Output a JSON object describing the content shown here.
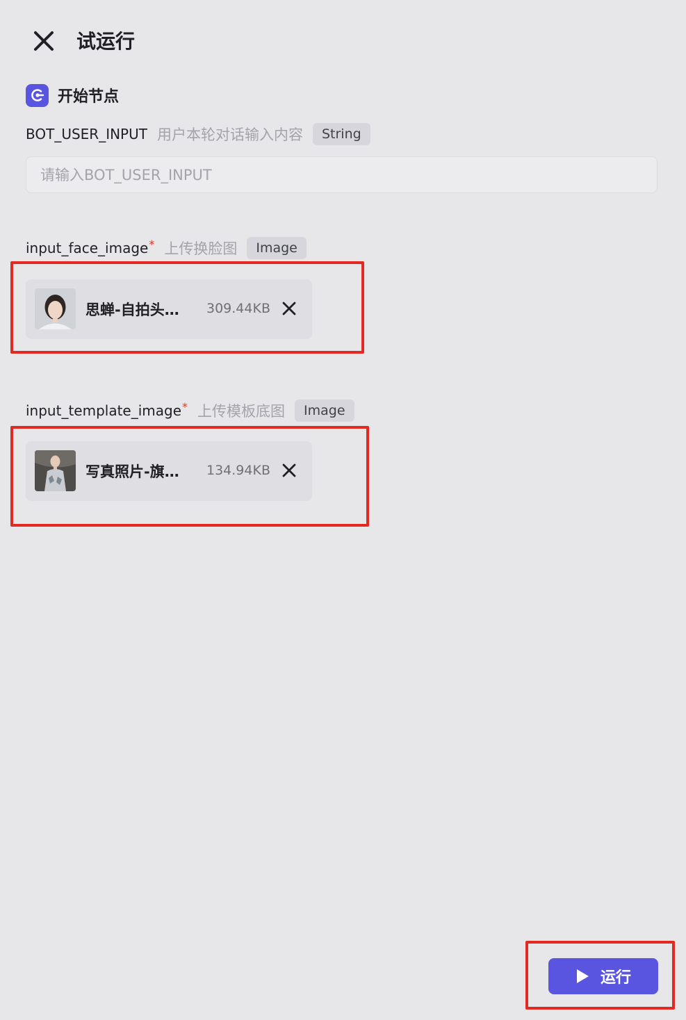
{
  "header": {
    "close_icon": "close-icon",
    "title": "试运行"
  },
  "start_node": {
    "icon": "start-node-icon",
    "icon_color": "#5a55e0",
    "title": "开始节点"
  },
  "params": [
    {
      "name": "BOT_USER_INPUT",
      "required": "",
      "description": "用户本轮对话输入内容",
      "type": "String",
      "placeholder": "请输入BOT_USER_INPUT",
      "value": ""
    },
    {
      "name": "input_face_image",
      "required": "*",
      "description": "上传换脸图",
      "type": "Image",
      "file": {
        "name": "思蝉-自拍头…",
        "size": "309.44KB",
        "remove_icon": "close-icon"
      }
    },
    {
      "name": "input_template_image",
      "required": "*",
      "description": "上传模板底图",
      "type": "Image",
      "file": {
        "name": "写真照片-旗…",
        "size": "134.94KB",
        "remove_icon": "close-icon"
      }
    }
  ],
  "footer": {
    "run_icon": "play-icon",
    "run_label": "运行",
    "accent_color": "#5a55e0"
  },
  "highlight_color": "#e02a22"
}
